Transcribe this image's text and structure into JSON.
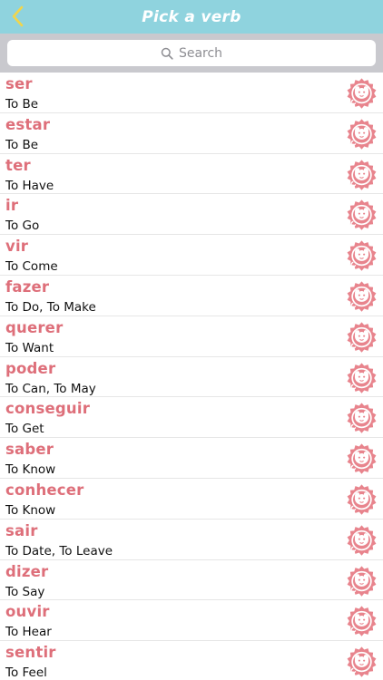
{
  "nav": {
    "title": "Pick a verb",
    "back_icon": "chevron-left-icon",
    "accent_color": "#8fd3de"
  },
  "search": {
    "placeholder": "Search",
    "icon": "search-icon"
  },
  "verb_color": "#de6f7a",
  "row_icon": "monkey-badge-icon",
  "verbs": [
    {
      "verb": "ser",
      "translation": "To Be"
    },
    {
      "verb": "estar",
      "translation": "To Be"
    },
    {
      "verb": "ter",
      "translation": "To Have"
    },
    {
      "verb": "ir",
      "translation": "To Go"
    },
    {
      "verb": "vir",
      "translation": "To Come"
    },
    {
      "verb": "fazer",
      "translation": "To Do, To Make"
    },
    {
      "verb": "querer",
      "translation": "To Want"
    },
    {
      "verb": "poder",
      "translation": "To Can, To May"
    },
    {
      "verb": "conseguir",
      "translation": "To Get"
    },
    {
      "verb": "saber",
      "translation": "To Know"
    },
    {
      "verb": "conhecer",
      "translation": "To Know"
    },
    {
      "verb": "sair",
      "translation": "To Date, To Leave"
    },
    {
      "verb": "dizer",
      "translation": "To Say"
    },
    {
      "verb": "ouvir",
      "translation": "To Hear"
    },
    {
      "verb": "sentir",
      "translation": "To Feel"
    }
  ]
}
